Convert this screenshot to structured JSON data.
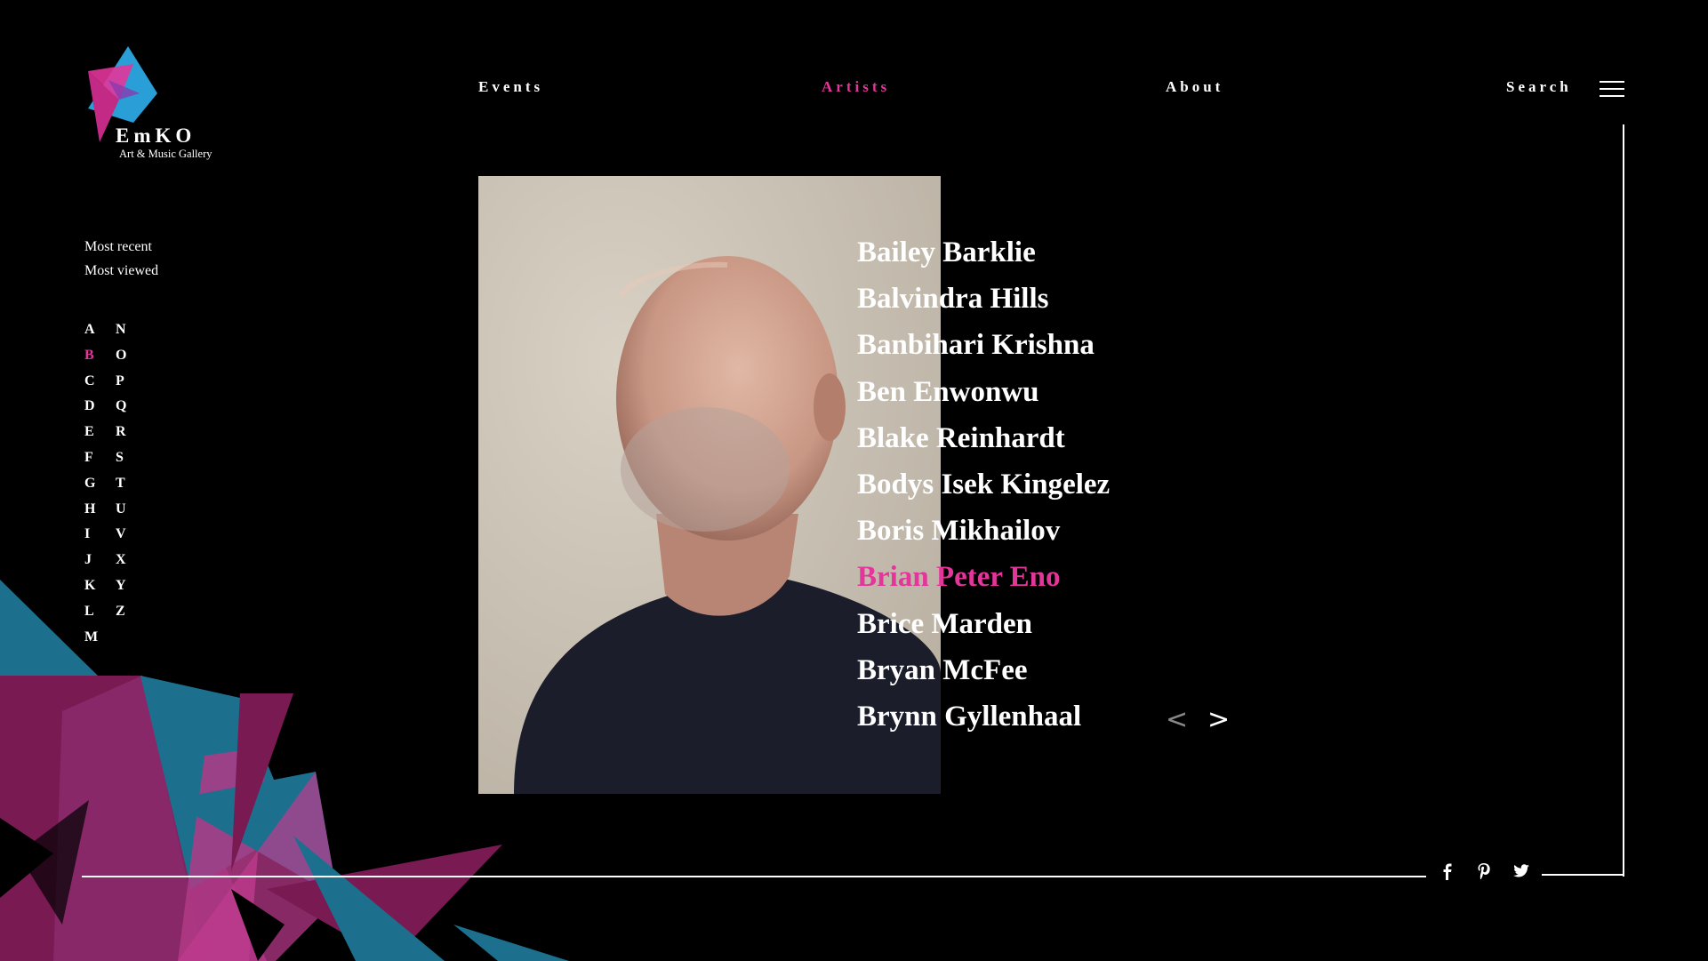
{
  "brand": {
    "name": "EmKO",
    "tagline": "Art & Music Gallery",
    "colors": {
      "accent": "#e3359a",
      "blue": "#2a9ed6",
      "teal": "#1d6f8e",
      "magenta": "#8a1a5a"
    }
  },
  "nav": {
    "events": "Events",
    "artists": "Artists",
    "about": "About",
    "search": "Search",
    "active": "Artists",
    "menu_icon": "hamburger-icon"
  },
  "sidebar": {
    "sort": {
      "recent": "Most recent",
      "viewed": "Most viewed"
    },
    "letters": [
      "A",
      "B",
      "C",
      "D",
      "E",
      "F",
      "G",
      "H",
      "I",
      "J",
      "K",
      "L",
      "M",
      "N",
      "O",
      "P",
      "Q",
      "R",
      "S",
      "T",
      "U",
      "V",
      "X",
      "Y",
      "Z"
    ],
    "active_letter": "B"
  },
  "artists": {
    "items": [
      "Bailey Barklie",
      "Balvindra Hills",
      "Banbihari Krishna",
      "Ben Enwonwu",
      "Blake Reinhardt",
      "Bodys Isek Kingelez",
      "Boris Mikhailov",
      "Brian Peter Eno",
      "Brice Marden",
      "Bryan McFee",
      "Brynn Gyllenhaal"
    ],
    "active": "Brian Peter Eno",
    "prev": "<",
    "next": ">"
  },
  "social": [
    "facebook-icon",
    "pinterest-icon",
    "twitter-icon"
  ]
}
